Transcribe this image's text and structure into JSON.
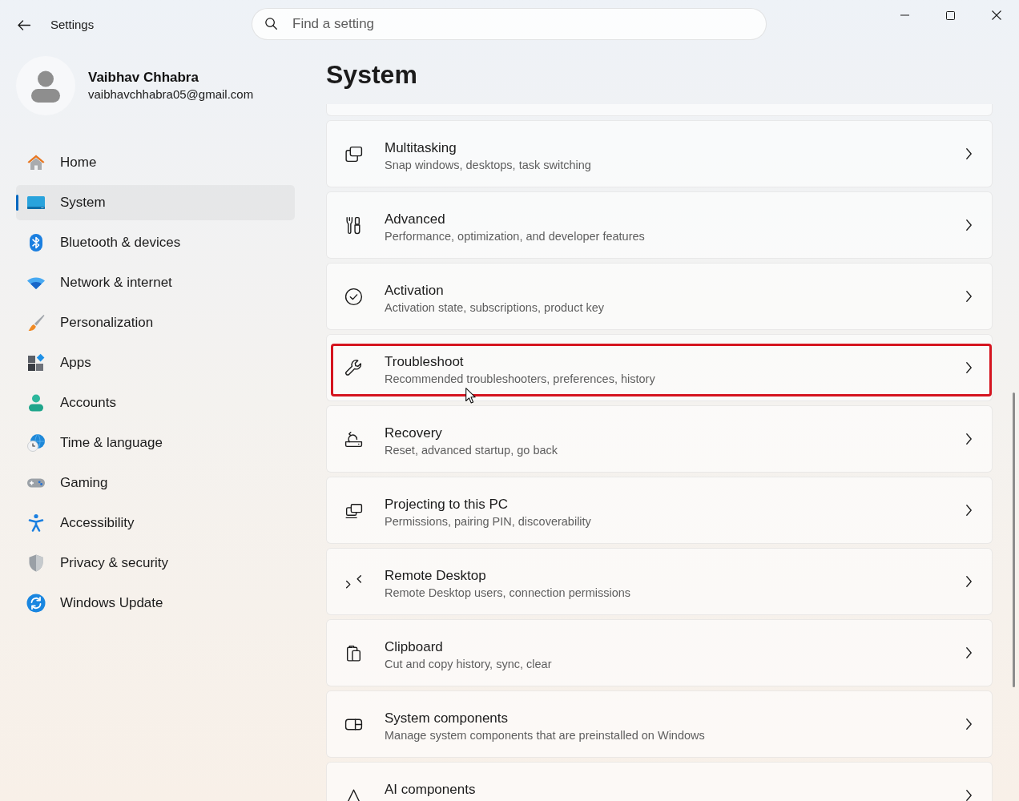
{
  "window": {
    "title": "Settings"
  },
  "search": {
    "placeholder": "Find a setting"
  },
  "profile": {
    "name": "Vaibhav Chhabra",
    "email": "vaibhavchhabra05@gmail.com"
  },
  "sidebar": {
    "items": [
      {
        "label": "Home",
        "selected": false
      },
      {
        "label": "System",
        "selected": true
      },
      {
        "label": "Bluetooth & devices",
        "selected": false
      },
      {
        "label": "Network & internet",
        "selected": false
      },
      {
        "label": "Personalization",
        "selected": false
      },
      {
        "label": "Apps",
        "selected": false
      },
      {
        "label": "Accounts",
        "selected": false
      },
      {
        "label": "Time & language",
        "selected": false
      },
      {
        "label": "Gaming",
        "selected": false
      },
      {
        "label": "Accessibility",
        "selected": false
      },
      {
        "label": "Privacy & security",
        "selected": false
      },
      {
        "label": "Windows Update",
        "selected": false
      }
    ]
  },
  "page": {
    "title": "System"
  },
  "settings": [
    {
      "title": "Multitasking",
      "description": "Snap windows, desktops, task switching",
      "highlighted": false
    },
    {
      "title": "Advanced",
      "description": "Performance, optimization, and developer features",
      "highlighted": false
    },
    {
      "title": "Activation",
      "description": "Activation state, subscriptions, product key",
      "highlighted": false
    },
    {
      "title": "Troubleshoot",
      "description": "Recommended troubleshooters, preferences, history",
      "highlighted": true
    },
    {
      "title": "Recovery",
      "description": "Reset, advanced startup, go back",
      "highlighted": false
    },
    {
      "title": "Projecting to this PC",
      "description": "Permissions, pairing PIN, discoverability",
      "highlighted": false
    },
    {
      "title": "Remote Desktop",
      "description": "Remote Desktop users, connection permissions",
      "highlighted": false
    },
    {
      "title": "Clipboard",
      "description": "Cut and copy history, sync, clear",
      "highlighted": false
    },
    {
      "title": "System components",
      "description": "Manage system components that are preinstalled on Windows",
      "highlighted": false
    },
    {
      "title": "AI components",
      "highlighted": false
    }
  ]
}
